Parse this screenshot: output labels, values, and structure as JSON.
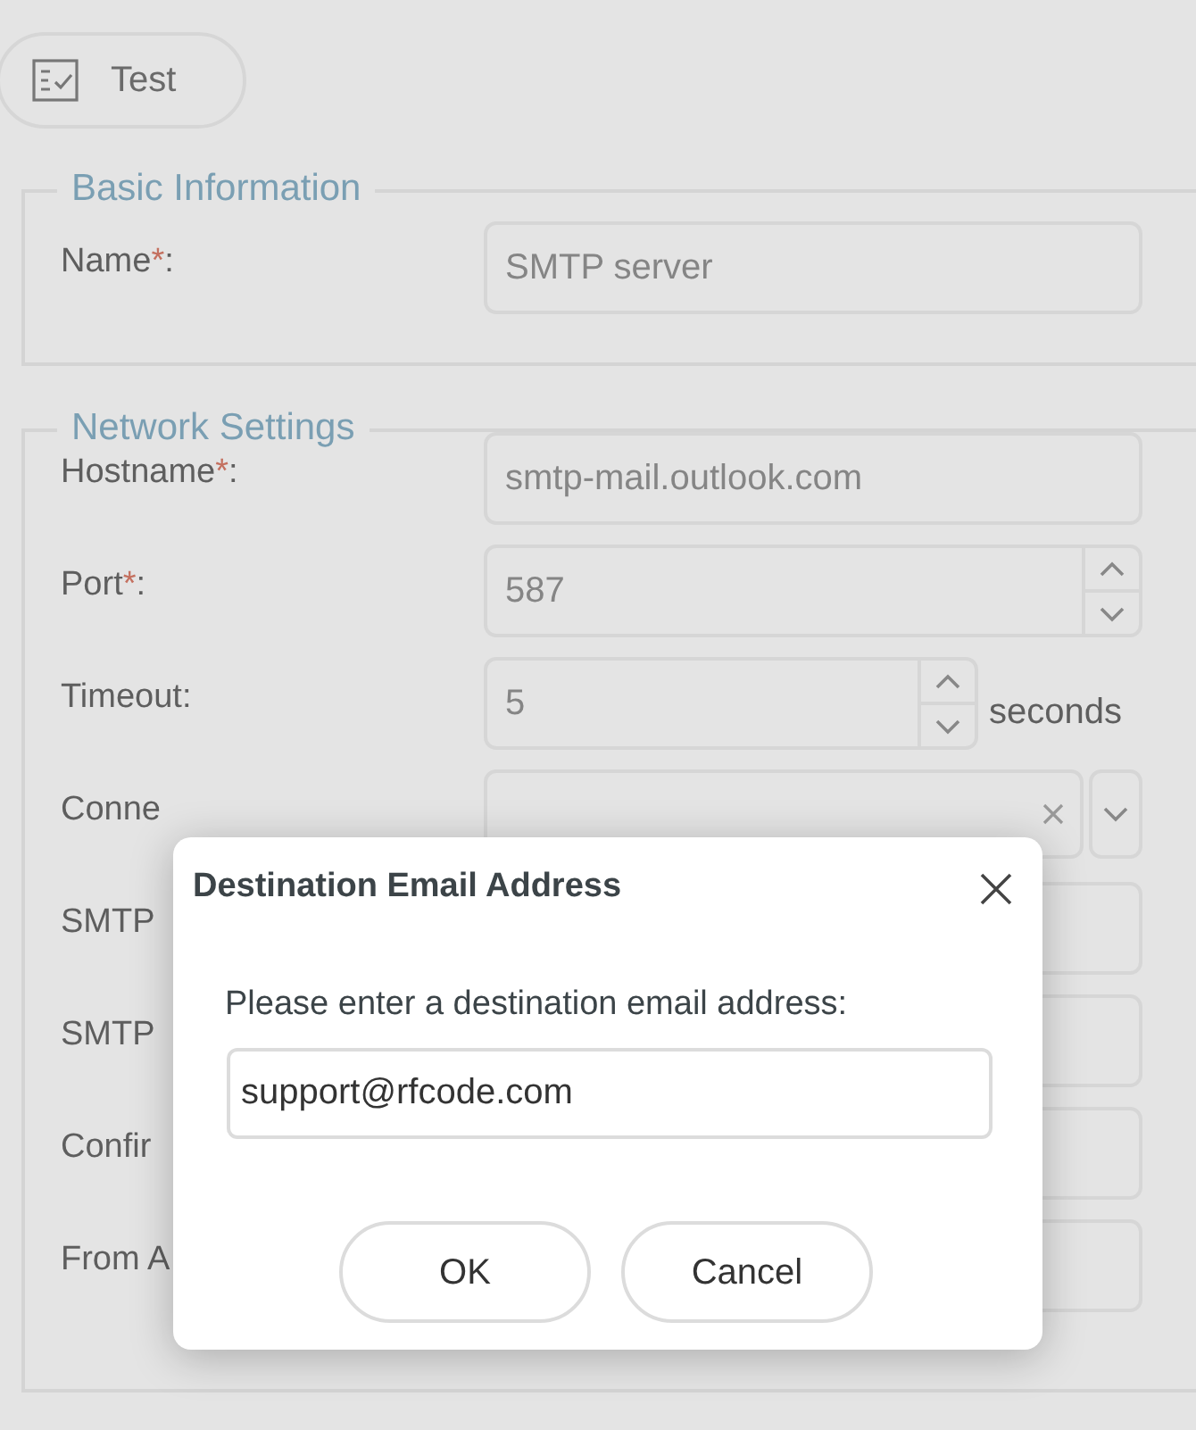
{
  "toolbar": {
    "test_button": "Test"
  },
  "sections": [
    {
      "legend": "Basic Information",
      "fields": [
        {
          "label": "Name",
          "required_mark": "*",
          "colon": ":",
          "kind": "text",
          "value": "SMTP server"
        }
      ]
    },
    {
      "legend": "Network Settings",
      "fields": [
        {
          "label": "Hostname",
          "required_mark": "*",
          "colon": ":",
          "kind": "text",
          "value": "smtp-mail.outlook.com"
        },
        {
          "label": "Port",
          "required_mark": "*",
          "colon": ":",
          "kind": "number",
          "value": "587"
        },
        {
          "label": "Timeout",
          "colon": ":",
          "kind": "number",
          "value": "5",
          "unit": "seconds"
        },
        {
          "label": "Conne",
          "kind": "select"
        },
        {
          "label": "SMTP",
          "kind": "text"
        },
        {
          "label": "SMTP",
          "kind": "text"
        },
        {
          "label": "Confir",
          "kind": "text"
        },
        {
          "label": "From A",
          "kind": "text"
        }
      ]
    }
  ],
  "dialog": {
    "title": "Destination Email Address",
    "prompt": "Please enter a destination email address:",
    "value": "support@rfcode.com",
    "buttons": [
      "OK",
      "Cancel"
    ]
  }
}
